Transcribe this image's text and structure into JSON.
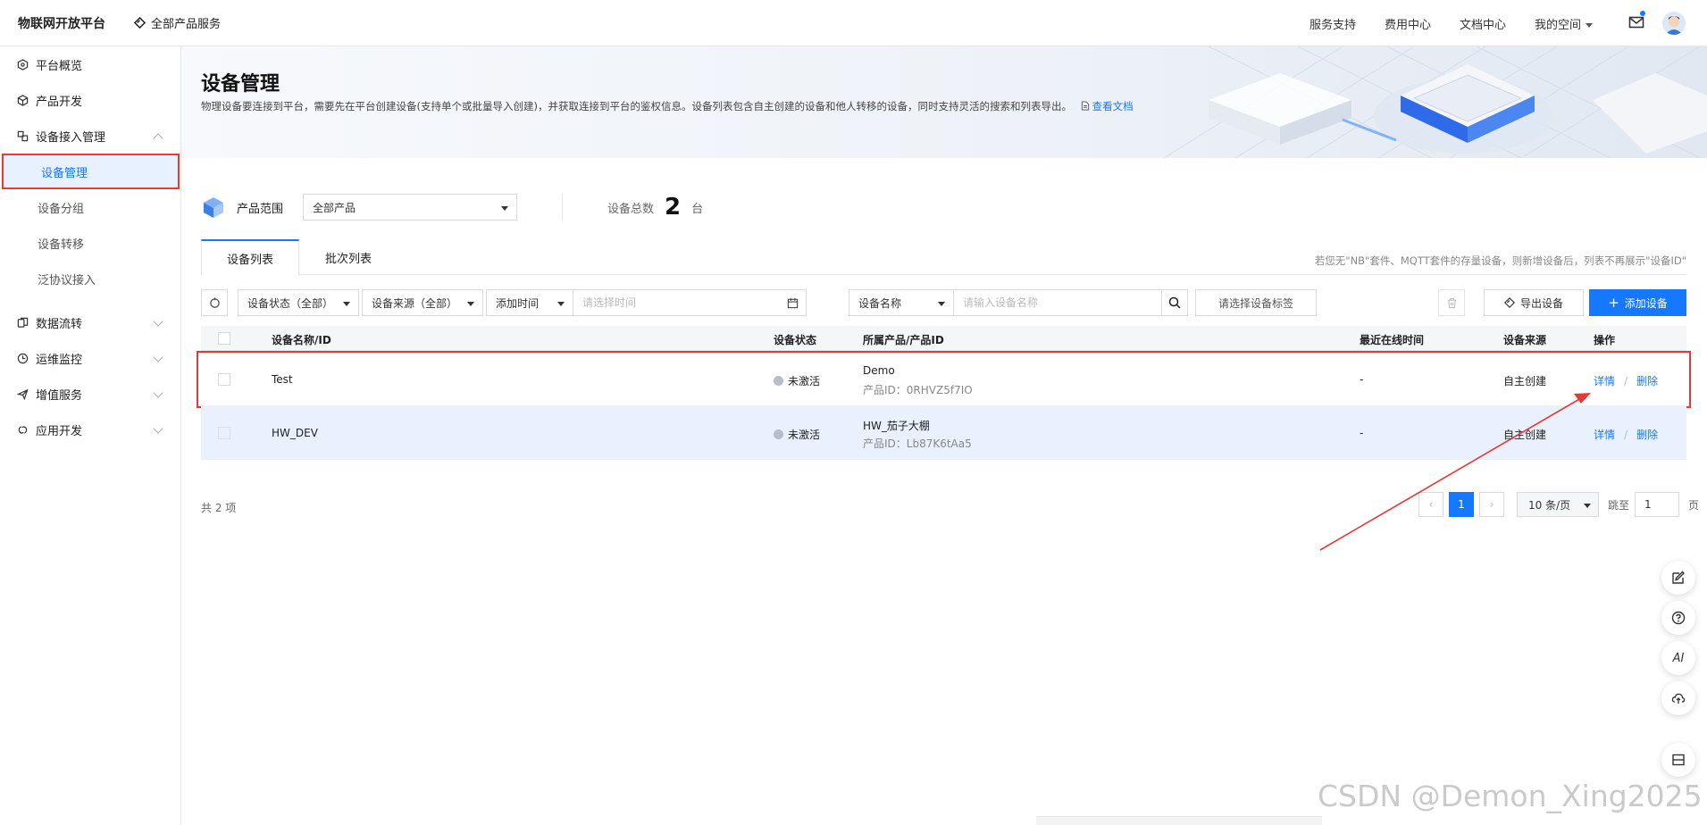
{
  "header": {
    "brand": "物联网开放平台",
    "all_products": "全部产品服务",
    "nav": [
      "服务支持",
      "费用中心",
      "文档中心",
      "我的空间"
    ]
  },
  "sidebar": {
    "items": [
      {
        "label": "平台概览",
        "icon": "platform-overview-icon"
      },
      {
        "label": "产品开发",
        "icon": "cube-icon"
      },
      {
        "label": "设备接入管理",
        "icon": "device-access-icon"
      },
      {
        "label": "设备管理"
      },
      {
        "label": "设备分组"
      },
      {
        "label": "设备转移"
      },
      {
        "label": "泛协议接入"
      },
      {
        "label": "数据流转",
        "icon": "data-flow-icon"
      },
      {
        "label": "运维监控",
        "icon": "monitor-icon"
      },
      {
        "label": "增值服务",
        "icon": "send-icon"
      },
      {
        "label": "应用开发",
        "icon": "app-dev-icon"
      }
    ]
  },
  "page": {
    "title": "设备管理",
    "description": "物理设备要连接到平台，需要先在平台创建设备(支持单个或批量导入创建)，并获取连接到平台的鉴权信息。设备列表包含自主创建的设备和他人转移的设备，同时支持灵活的搜索和列表导出。",
    "doc_link": "查看文档"
  },
  "scope": {
    "label": "产品范围",
    "selected": "全部产品",
    "total_label": "设备总数",
    "total_value": "2",
    "total_unit": "台"
  },
  "tabs": {
    "items": [
      "设备列表",
      "批次列表"
    ],
    "tip": "若您无\"NB\"套件、MQTT套件的存量设备，则新增设备后，列表不再展示\"设备ID\""
  },
  "toolbar": {
    "status_filter": "设备状态（全部）",
    "source_filter": "设备来源（全部）",
    "time_filter": "添加时间",
    "time_placeholder": "请选择时间",
    "name_filter": "设备名称",
    "name_placeholder": "请输入设备名称",
    "tag_placeholder": "请选择设备标签",
    "export_label": "导出设备",
    "add_label": "添加设备"
  },
  "table": {
    "columns": [
      "设备名称/ID",
      "设备状态",
      "所属产品/产品ID",
      "最近在线时间",
      "设备来源",
      "操作"
    ],
    "rows": [
      {
        "name": "Test",
        "status": "未激活",
        "product": "Demo",
        "product_id": "产品ID：0RHVZ5f7IO",
        "last_online": "-",
        "source": "自主创建",
        "detail": "详情",
        "delete": "删除"
      },
      {
        "name": "HW_DEV",
        "status": "未激活",
        "product": "HW_茄子大棚",
        "product_id": "产品ID：Lb87K6tAa5",
        "last_online": "-",
        "source": "自主创建",
        "detail": "详情",
        "delete": "删除"
      }
    ]
  },
  "pagination": {
    "total": "共 2 项",
    "current": "1",
    "page_size": "10 条/页",
    "jump_label": "跳至",
    "jump_value": "1",
    "page_unit": "页"
  },
  "float_tools": {
    "ai_label": "AI"
  },
  "watermark": "CSDN @Demon_Xing2025",
  "colors": {
    "accent": "#1677ff",
    "annotation": "#e53935"
  }
}
